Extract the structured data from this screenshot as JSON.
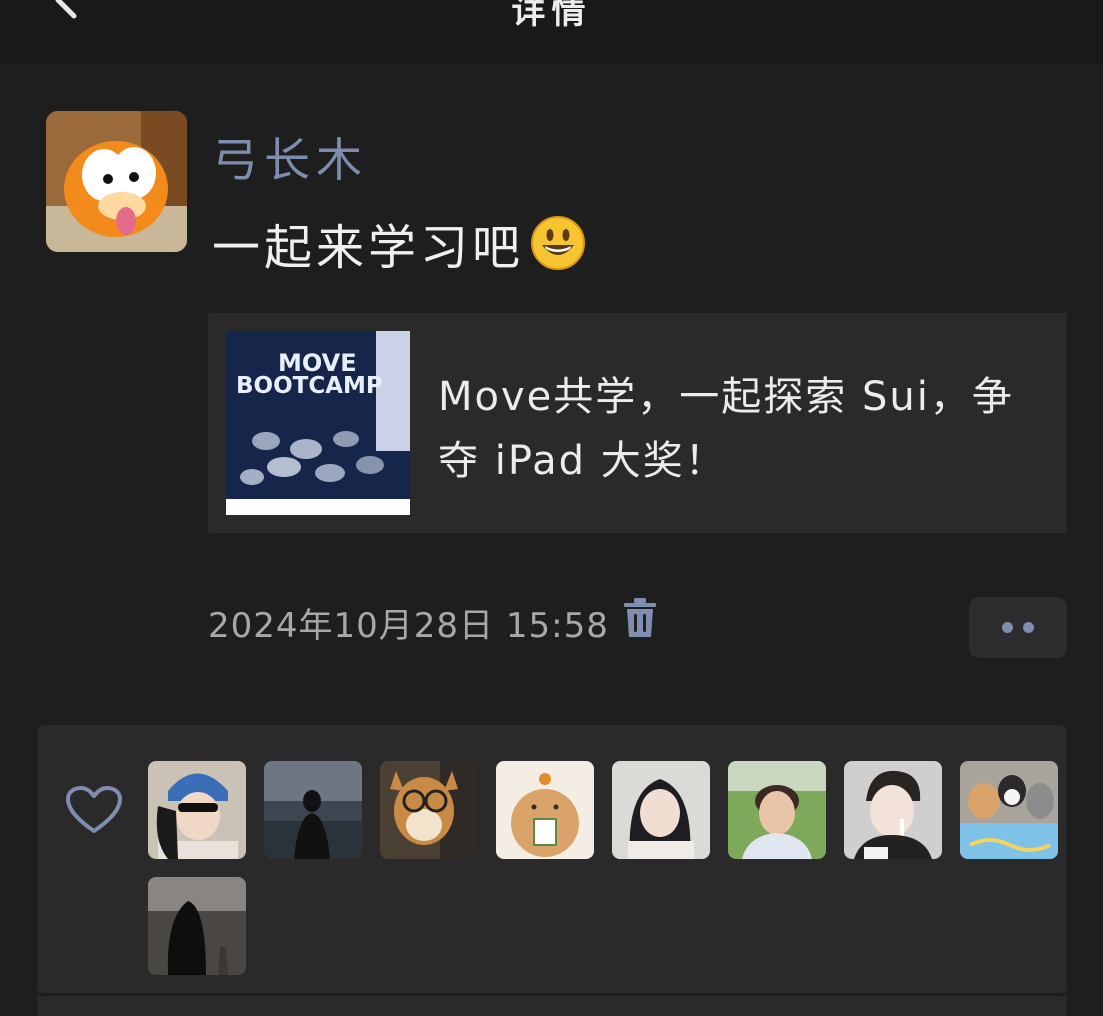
{
  "header": {
    "title": "详情",
    "back_icon": "chevron-left-icon"
  },
  "post": {
    "author": "弓长木",
    "text": "一起来学习吧",
    "emoji": "grinning-face-emoji",
    "link_card": {
      "title": "Move共学，一起探索 Sui，争夺 iPad 大奖！",
      "thumbnail_lines": [
        "MOVE",
        "BOOTCAMP"
      ]
    },
    "timestamp": "2024年10月28日  15:58",
    "delete_icon": "trash-icon",
    "more_icon": "more-dots-icon"
  },
  "likes": {
    "icon": "heart-outline-icon",
    "likers": [
      "liker-1",
      "liker-2",
      "liker-3",
      "liker-4",
      "liker-5",
      "liker-6",
      "liker-7",
      "liker-8",
      "liker-9"
    ]
  },
  "colors": {
    "accent": "#7d8dae",
    "background": "#1e1e1e",
    "card": "#2a2a2a"
  }
}
